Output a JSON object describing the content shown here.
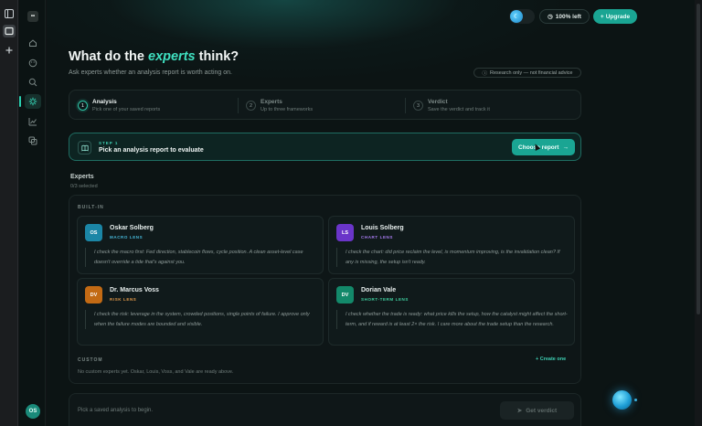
{
  "browser_strip": {
    "icons": [
      "sidebar-panel-icon",
      "tab-icon",
      "plus-icon"
    ]
  },
  "sidebar": {
    "logo": "••",
    "items": [
      {
        "icon": "home-icon"
      },
      {
        "icon": "palette-icon"
      },
      {
        "icon": "search-icon"
      },
      {
        "icon": "scale-icon",
        "active": true
      },
      {
        "icon": "chart-icon"
      },
      {
        "icon": "copy-icon"
      }
    ],
    "avatar": "OS"
  },
  "header": {
    "usage": "100% left",
    "upgrade": "Upgrade",
    "upgrade_icon": "+"
  },
  "page": {
    "title_prefix": "What do the ",
    "title_accent": "experts",
    "title_suffix": " think?",
    "subtitle": "Ask experts whether an analysis report is worth acting on.",
    "disclaimer": "Research only — not financial advice"
  },
  "steps": [
    {
      "num": "1",
      "title": "Analysis",
      "desc": "Pick one of your saved reports",
      "active": true
    },
    {
      "num": "2",
      "title": "Experts",
      "desc": "Up to three frameworks"
    },
    {
      "num": "3",
      "title": "Verdict",
      "desc": "Save the verdict and track it"
    }
  ],
  "pick": {
    "step_label": "STEP 1",
    "label": "Pick an analysis report to evaluate",
    "button": "Choose report",
    "button_arrow": "→"
  },
  "experts": {
    "label": "Experts",
    "count": "0/3 selected",
    "builtin_label": "BUILT-IN",
    "cards": [
      {
        "initials": "OS",
        "name": "Oskar Solberg",
        "role": "MACRO LENS",
        "color": "#1b86a6",
        "role_color": "#46b7d8",
        "quote": "I check the macro first: Fed direction, stablecoin flows, cycle position. A clean asset-level case doesn't override a tide that's against you."
      },
      {
        "initials": "LS",
        "name": "Louis Solberg",
        "role": "CHART LENS",
        "color": "#6a35c9",
        "role_color": "#a77bf0",
        "quote": "I check the chart: did price reclaim the level, is momentum improving, is the invalidation clean? If any is missing, the setup isn't ready."
      },
      {
        "initials": "DV",
        "name": "Dr. Marcus Voss",
        "role": "RISK LENS",
        "color": "#c26a14",
        "role_color": "#e39a4a",
        "quote": "I check the risk: leverage in the system, crowded positions, single points of failure. I approve only when the failure modes are bounded and visible."
      },
      {
        "initials": "DV",
        "name": "Dorian Vale",
        "role": "SHORT-TERM LENS",
        "color": "#13896a",
        "role_color": "#3fd0a0",
        "quote": "I check whether the trade is ready: what price kills the setup, how the catalyst might affect the short-term, and if reward is at least 2× the risk. I care more about the trade setup than the research."
      }
    ],
    "custom_label": "CUSTOM",
    "create_one": "+ Create one",
    "custom_desc": "No custom experts yet. Oskar, Louis, Voss, and Vale are ready above."
  },
  "bottom": {
    "hint": "Pick a saved analysis to begin.",
    "verdict_button": "Get verdict"
  }
}
